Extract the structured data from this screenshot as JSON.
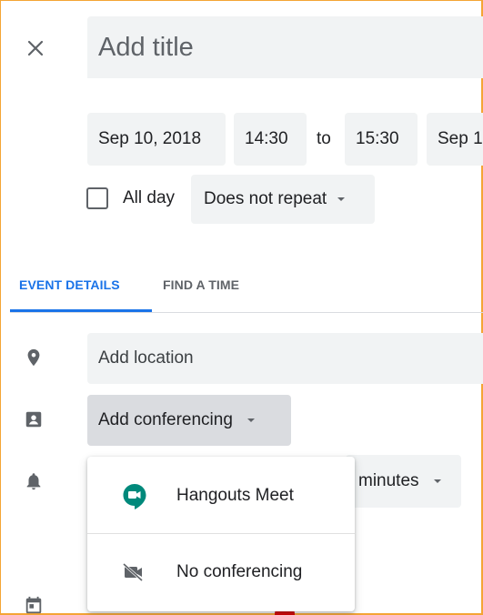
{
  "header": {
    "title_placeholder": "Add title"
  },
  "datetime": {
    "start_date": "Sep 10, 2018",
    "start_time": "14:30",
    "to_label": "to",
    "end_time": "15:30",
    "end_date": "Sep 1"
  },
  "options": {
    "all_day_label": "All day",
    "repeat_value": "Does not repeat"
  },
  "tabs": [
    {
      "label": "EVENT DETAILS",
      "active": true
    },
    {
      "label": "FIND A TIME",
      "active": false
    }
  ],
  "details": {
    "location_placeholder": "Add location",
    "conferencing_label": "Add conferencing",
    "notification_unit": "minutes"
  },
  "conferencing_menu": {
    "items": [
      {
        "label": "Hangouts Meet",
        "icon": "hangouts-meet-icon"
      },
      {
        "label": "No conferencing",
        "icon": "video-off-icon"
      }
    ]
  },
  "colors": {
    "accent": "#1a73e8",
    "frame_border": "#f4a535",
    "field_background": "#f1f3f4",
    "hangouts_green": "#00897b"
  }
}
